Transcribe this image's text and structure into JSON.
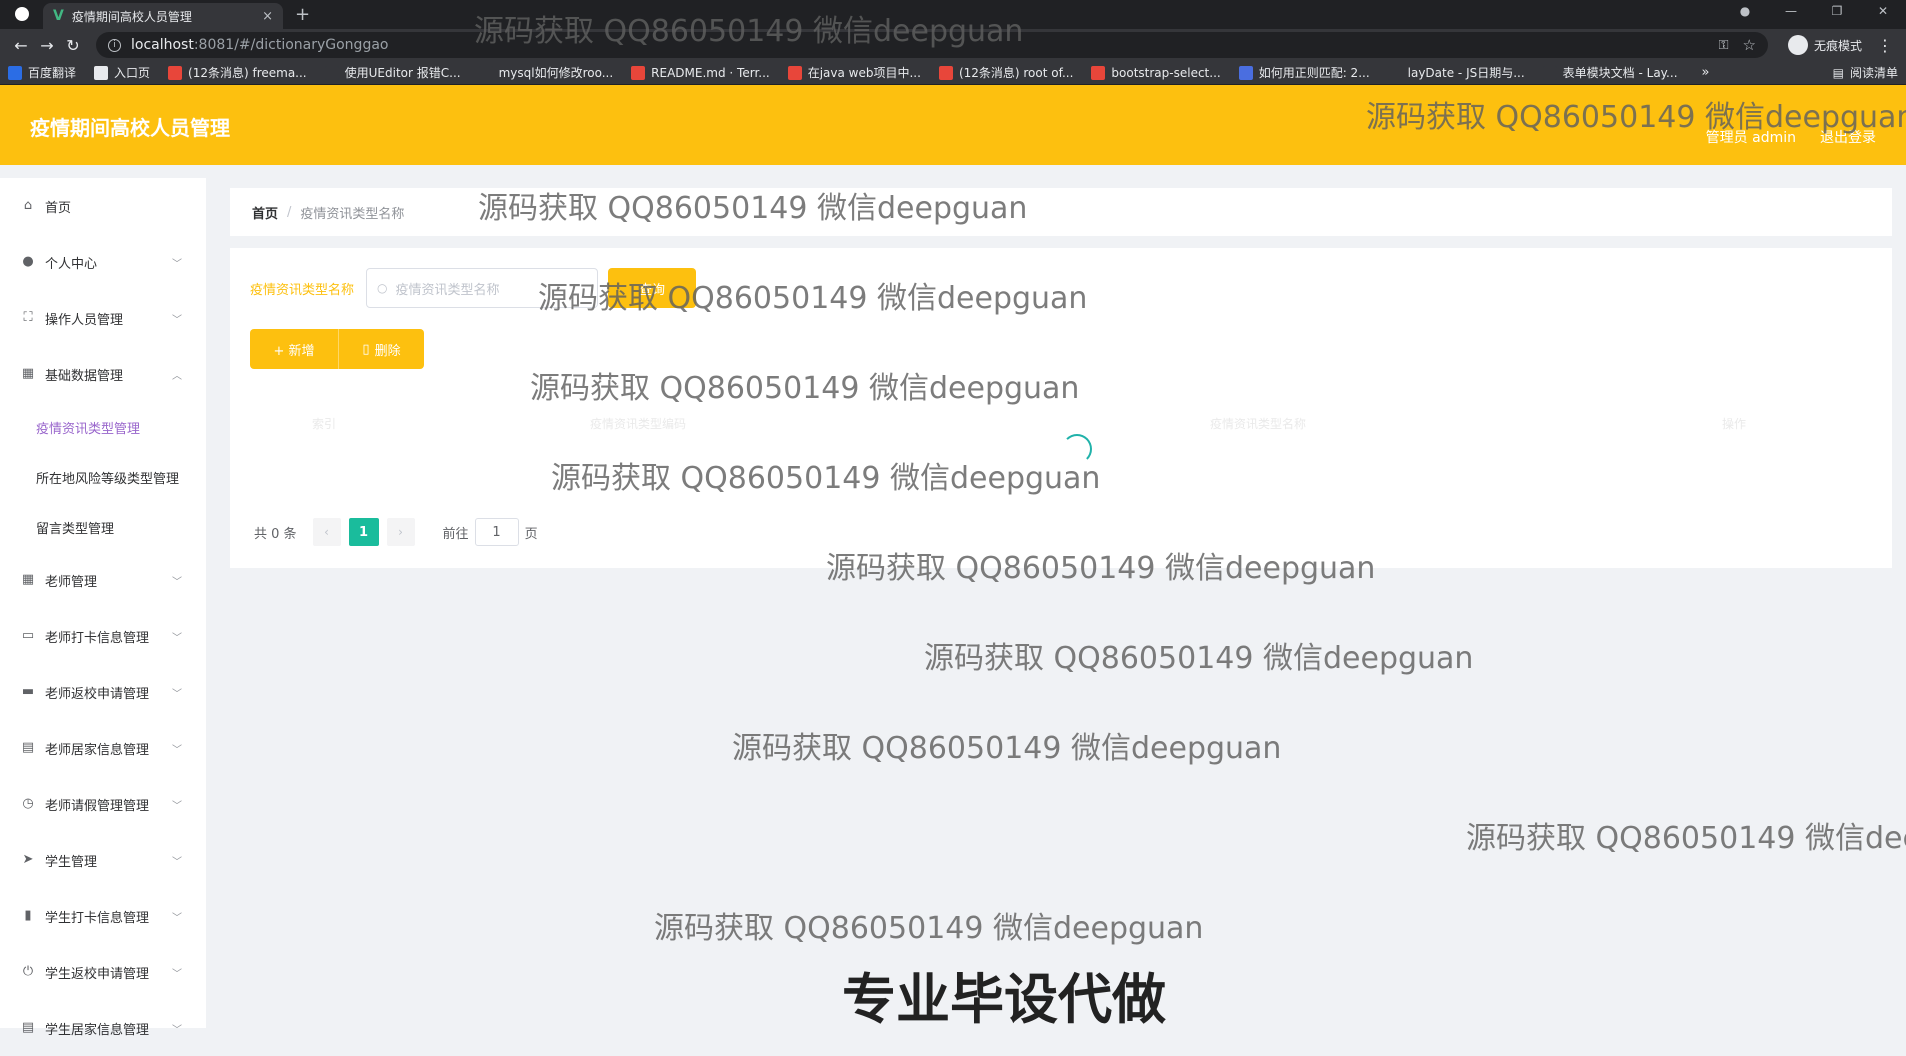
{
  "browser": {
    "tab_title": "疫情期间高校人员管理",
    "tab_close": "×",
    "new_tab": "+",
    "url_host": "localhost",
    "url_path": ":8081/#/dictionaryGonggao",
    "incognito_label": "无痕模式",
    "bookmarks": [
      {
        "label": "百度翻译",
        "color": "#2b6de5"
      },
      {
        "label": "入口页",
        "color": "#e8eaed"
      },
      {
        "label": "(12条消息) freema...",
        "color": "#e8463a"
      },
      {
        "label": "使用UEditor 报错C...",
        "color": "#35363a"
      },
      {
        "label": "mysql如何修改roo...",
        "color": "#35363a"
      },
      {
        "label": "README.md · Terr...",
        "color": "#e8463a"
      },
      {
        "label": "在java web项目中...",
        "color": "#e8463a"
      },
      {
        "label": "(12条消息) root of...",
        "color": "#e8463a"
      },
      {
        "label": "bootstrap-select...",
        "color": "#e8463a"
      },
      {
        "label": "如何用正则匹配: 2...",
        "color": "#4a6ee0"
      },
      {
        "label": "layDate - JS日期与...",
        "color": "#35363a"
      },
      {
        "label": "表单模块文档 - Lay...",
        "color": "#35363a"
      }
    ],
    "more_bookmarks": "»",
    "reading_list": "阅读清单"
  },
  "header": {
    "title": "疫情期间高校人员管理",
    "user_label": "管理员 admin",
    "logout_label": "退出登录"
  },
  "sidebar": {
    "items": [
      {
        "label": "首页",
        "icon": "home-icon",
        "glyph": "⌂",
        "has_children": false
      },
      {
        "label": "个人中心",
        "icon": "user-icon",
        "glyph": "●",
        "has_children": true
      },
      {
        "label": "操作人员管理",
        "icon": "fullscreen-icon",
        "glyph": "⛶",
        "has_children": true
      },
      {
        "label": "基础数据管理",
        "icon": "grid-icon",
        "glyph": "▦",
        "has_children": true,
        "expanded": true
      }
    ],
    "sub_items": [
      {
        "label": "疫情资讯类型管理",
        "active": true
      },
      {
        "label": "所在地风险等级类型管理",
        "active": false
      },
      {
        "label": "留言类型管理",
        "active": false
      }
    ],
    "more_items": [
      {
        "label": "老师管理",
        "icon": "grid-icon",
        "glyph": "▦"
      },
      {
        "label": "老师打卡信息管理",
        "icon": "chat-icon",
        "glyph": "▭"
      },
      {
        "label": "老师返校申请管理",
        "icon": "camera-icon",
        "glyph": "▬"
      },
      {
        "label": "老师居家信息管理",
        "icon": "briefcase-icon",
        "glyph": "▤"
      },
      {
        "label": "老师请假管理管理",
        "icon": "clock-icon",
        "glyph": "◷"
      },
      {
        "label": "学生管理",
        "icon": "send-icon",
        "glyph": "➤"
      },
      {
        "label": "学生打卡信息管理",
        "icon": "chart-icon",
        "glyph": "▮"
      },
      {
        "label": "学生返校申请管理",
        "icon": "power-icon",
        "glyph": "⏻"
      },
      {
        "label": "学生居家信息管理",
        "icon": "briefcase-icon",
        "glyph": "▤"
      }
    ]
  },
  "breadcrumb": {
    "home": "首页",
    "separator": "/",
    "current": "疫情资讯类型名称"
  },
  "search": {
    "label": "疫情资讯类型名称",
    "placeholder": "疫情资讯类型名称",
    "button": "查询"
  },
  "actions": {
    "add": "+ 新增",
    "delete": "删除"
  },
  "table": {
    "columns": [
      "索引",
      "疫情资讯类型编码",
      "疫情资讯类型名称",
      "操作"
    ]
  },
  "pagination": {
    "total": "共 0 条",
    "prev": "‹",
    "current_page": "1",
    "next": "›",
    "goto_label": "前往",
    "goto_value": "1",
    "page_suffix": "页"
  },
  "watermark": {
    "text": "源码获取 QQ86050149 微信deepguan",
    "bottom_text": "专业毕设代做"
  }
}
